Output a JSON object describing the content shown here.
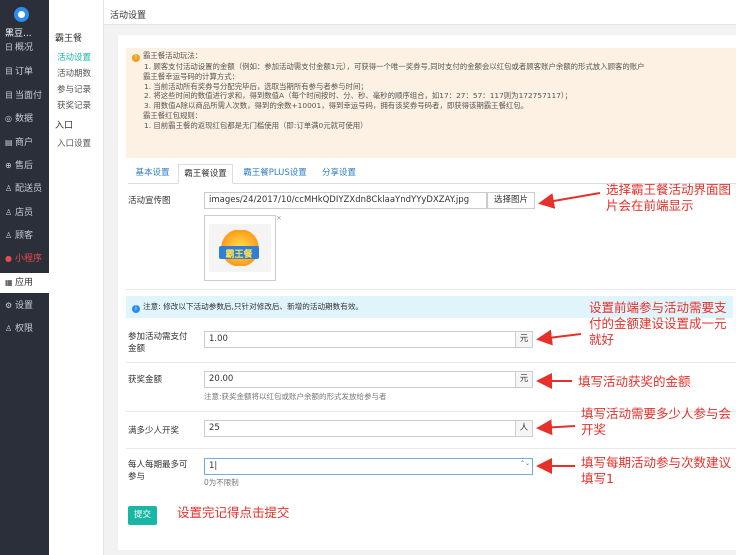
{
  "sidebar": {
    "brand": "黑豆...",
    "items": [
      {
        "icon": "日",
        "label": "概况"
      },
      {
        "icon": "目",
        "label": "订单"
      },
      {
        "icon": "目",
        "label": "当面付"
      },
      {
        "icon": "◎",
        "label": "数据"
      },
      {
        "icon": "▤",
        "label": "商户"
      },
      {
        "icon": "⊕",
        "label": "售后"
      },
      {
        "icon": "♙",
        "label": "配送员"
      },
      {
        "icon": "♙",
        "label": "店员"
      },
      {
        "icon": "♙",
        "label": "顾客"
      },
      {
        "icon": "●",
        "label": "小程序"
      },
      {
        "icon": "▦",
        "label": "应用"
      },
      {
        "icon": "⚙",
        "label": "设置"
      },
      {
        "icon": "♙",
        "label": "权限"
      }
    ]
  },
  "subnav": {
    "title": "霸王餐",
    "items": [
      "活动设置",
      "活动期数",
      "参与记录",
      "获奖记录"
    ],
    "title2": "入口",
    "items2": [
      "入口设置"
    ]
  },
  "topbar": {
    "title": "活动设置"
  },
  "notice": {
    "lines": [
      "霸王餐活动玩法：",
      "1. 顾客支付活动设置的金额（例如：参加活动需支付金额1元），可获得一个唯一奖券号,同时支付的金额会以红包或者顾客账户余额的形式放入顾客的账户",
      "霸王餐幸运号码的计算方式：",
      "1. 当前活动所有奖券号分配完毕后，选取当期所有参与者参与时间；",
      "2. 将这些时间的数值进行求和，得到数值A（每个时间按时、分、秒、毫秒的顺序组合，如17：27：57：117则为172757117）；",
      "3. 用数值A除以商品所需人次数，得到的余数+10001，得到幸运号码，拥有该奖券号码者，即获得该期霸王餐红包。",
      "霸王餐红包规则：",
      "1. 目前霸王餐的返现红包都是无门槛使用（即:订单满0元就可使用）"
    ]
  },
  "tabs": [
    "基本设置",
    "霸王餐设置",
    "霸王餐PLUS设置",
    "分享设置"
  ],
  "form": {
    "banner_label": "活动宣传图",
    "banner_path": "images/24/2017/10/ccMHkQDIYZXdn8CklaaYndYYyDXZAY.jpg",
    "select_image": "选择图片",
    "thumb_text": "霸王餐",
    "thumb_close": "×",
    "info": "注意: 修改以下活动参数后,只针对修改后、新增的活动期数有效。",
    "info_icon": "i",
    "notice_icon": "!",
    "pay_label": "参加活动需支付金额",
    "pay_value": "1.00",
    "pay_unit": "元",
    "prize_label": "获奖金额",
    "prize_value": "20.00",
    "prize_unit": "元",
    "prize_help": "注意:获奖金额将以红包或账户余额的形式发放给参与者",
    "people_label": "满多少人开奖",
    "people_value": "25",
    "people_unit": "人",
    "times_label": "每人每期最多可参与",
    "times_value": "1|",
    "times_help": "0为不限制",
    "stepper": "⌃⌄",
    "submit": "提交"
  },
  "annotations": [
    "选择霸王餐活动界面图片会在前端显示",
    "设置前端参与活动需要支付的金额建设设置成一元就好",
    "填写活动获奖的金额",
    "填写活动需要多少人参与会开奖",
    "填写每期活动参与次数建议填写1",
    "设置完记得点击提交"
  ]
}
